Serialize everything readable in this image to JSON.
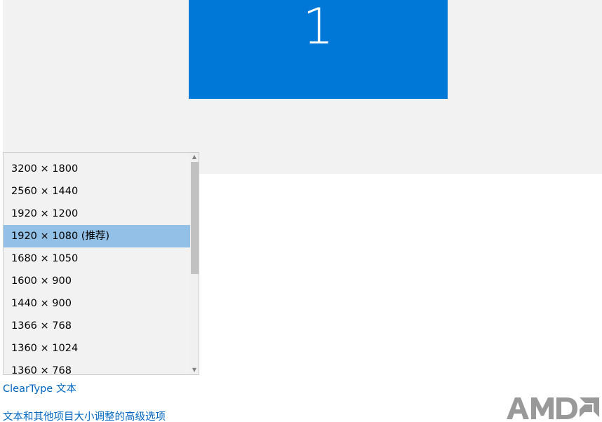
{
  "display": {
    "monitor_number": "1"
  },
  "resolution_dropdown": {
    "options": [
      "3200 × 1800",
      "2560 × 1440",
      "1920 × 1200",
      "1920 × 1080 (推荐)",
      "1680 × 1050",
      "1600 × 900",
      "1440 × 900",
      "1366 × 768",
      "1360 × 1024",
      "1360 × 768"
    ],
    "selected_value": "1920 × 1080 (推荐)"
  },
  "links": {
    "cleartype": "ClearType 文本",
    "advanced_sizing": "文本和其他项目大小调整的高级选项"
  },
  "logo": {
    "text": "AMD",
    "color": "#999999"
  },
  "colors": {
    "accent": "#0078d7",
    "selection": "#92c0e6",
    "link": "#0067c0"
  },
  "icons": {
    "scroll_up": "chevron-up-icon",
    "scroll_down": "chevron-down-icon"
  }
}
